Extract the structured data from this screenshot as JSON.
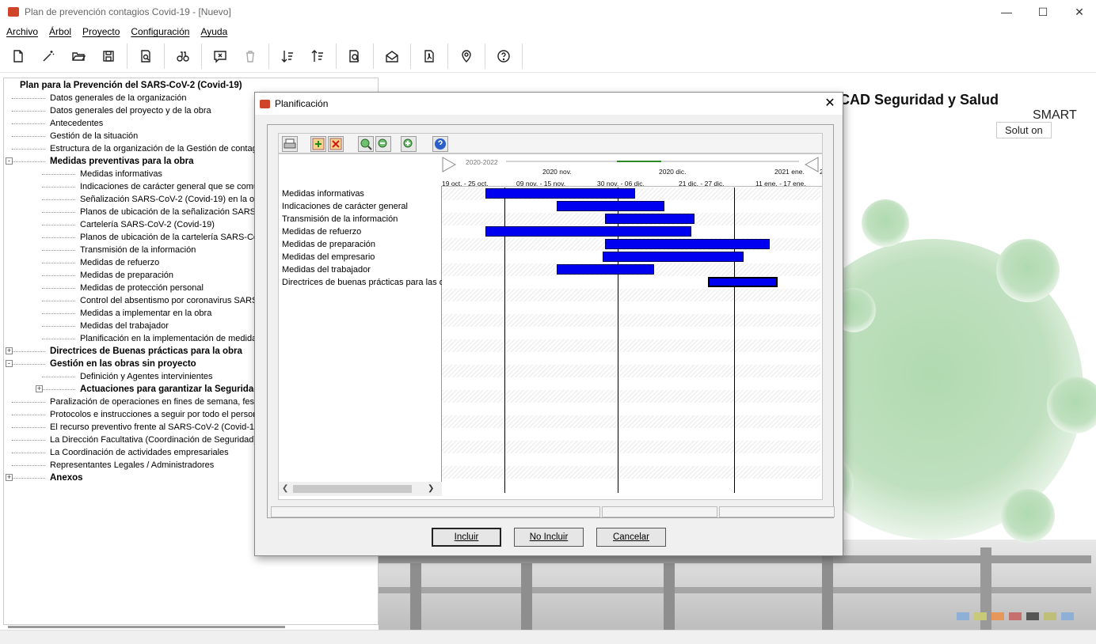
{
  "window": {
    "title": "Plan de prevención contagios Covid-19 - [Nuevo]"
  },
  "menu": [
    "Archivo",
    "Árbol",
    "Proyecto",
    "Configuración",
    "Ayuda"
  ],
  "toolbar": [
    "new-icon",
    "wand-icon",
    "open-icon",
    "save-icon",
    "preview-icon",
    "binoculars-icon",
    "comment-icon",
    "trash-icon",
    "sort-down-icon",
    "sort-up-icon",
    "search-doc-icon",
    "mail-icon",
    "pdf-icon",
    "location-icon",
    "help-icon"
  ],
  "tree": {
    "root": "Plan para la Prevención del SARS-CoV-2 (Covid-19)",
    "items": [
      {
        "label": "Datos generales de la organización"
      },
      {
        "label": "Datos generales del proyecto y de la obra"
      },
      {
        "label": "Antecedentes"
      },
      {
        "label": "Gestión de la situación"
      },
      {
        "label": "Estructura de la organización de la Gestión de contagio"
      },
      {
        "label": "Medidas preventivas para la obra"
      },
      {
        "label": "Medidas informativas"
      },
      {
        "label": "Indicaciones de carácter general que se comur"
      },
      {
        "label": "Señalización SARS-CoV-2 (Covid-19) en la obra"
      },
      {
        "label": "Planos de ubicación de la señalización SARS-C"
      },
      {
        "label": "Cartelería SARS-CoV-2 (Covid-19)"
      },
      {
        "label": "Planos de ubicación de la cartelería SARS-CoV"
      },
      {
        "label": "Transmisión de la información"
      },
      {
        "label": "Medidas de refuerzo"
      },
      {
        "label": "Medidas de preparación"
      },
      {
        "label": "Medidas de protección personal"
      },
      {
        "label": "Control del absentismo por coronavirus SARS-C"
      },
      {
        "label": "Medidas a implementar en la obra"
      },
      {
        "label": "Medidas del trabajador"
      },
      {
        "label": "Planificación en la implementación de medidas"
      },
      {
        "label": "Directrices de Buenas prácticas para la obra"
      },
      {
        "label": "Gestión en las obras sin proyecto"
      },
      {
        "label": "Definición y Agentes intervinientes"
      },
      {
        "label": "Actuaciones para garantizar la Seguridad"
      },
      {
        "label": "Paralización de operaciones en fines de semana, festiv"
      },
      {
        "label": "Protocolos e instrucciones a seguir por todo el persona"
      },
      {
        "label": "El recurso preventivo frente al SARS-CoV-2 (Covid-19)"
      },
      {
        "label": "La Dirección Facultativa (Coordinación de Seguridad) f"
      },
      {
        "label": "La Coordinación de actividades empresariales"
      },
      {
        "label": "Representantes Legales / Administradores"
      },
      {
        "label": "Anexos"
      }
    ]
  },
  "brand": {
    "line1": "CAD Seguridad y Salud",
    "line2": "SMART",
    "line3": "Solut on"
  },
  "dialog": {
    "title": "Planificación",
    "timeline": {
      "range": "2020-2022",
      "months": [
        "2020 nov.",
        "2020 dic.",
        "2021 ene.",
        "2"
      ],
      "weeks": [
        "19 oct. - 25 oct.",
        "09 nov. - 15 nov.",
        "30 nov. - 06 dic.",
        "21 dic. - 27 dic.",
        "11 ene. - 17 ene."
      ]
    },
    "tasks": [
      {
        "name": "Medidas informativas"
      },
      {
        "name": "Indicaciones de carácter general"
      },
      {
        "name": "Transmisión de la información"
      },
      {
        "name": "Medidas de refuerzo"
      },
      {
        "name": "Medidas de preparación"
      },
      {
        "name": "Medidas del empresario"
      },
      {
        "name": "Medidas del trabajador"
      },
      {
        "name": "Directrices de buenas prácticas para las o"
      }
    ],
    "buttons": {
      "include": "Incluir",
      "exclude": "No Incluir",
      "cancel": "Cancelar"
    }
  }
}
